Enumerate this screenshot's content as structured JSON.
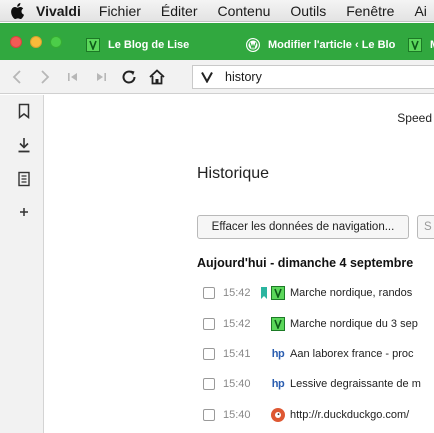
{
  "menubar": {
    "app_name": "Vivaldi",
    "items": [
      "Fichier",
      "Éditer",
      "Contenu",
      "Outils",
      "Fenêtre",
      "Ai"
    ]
  },
  "tabs": [
    {
      "label": "Le Blog de Lise",
      "favicon": "blog-favicon"
    },
    {
      "label": "Modifier l'article ‹ Le Blo",
      "favicon": "wordpress-icon"
    },
    {
      "label": "M",
      "favicon": "blog-favicon"
    }
  ],
  "toolbar": {
    "address_value": "history"
  },
  "content": {
    "speed_dial_label": "Speed",
    "title": "Historique",
    "clear_button": "Effacer les données de navigation...",
    "second_button": "S",
    "day_heading": "Aujourd'hui - dimanche 4 septembre",
    "rows": [
      {
        "time": "15:42",
        "title": "Marche nordique, randos",
        "favicon": "blog-favicon",
        "bookmarked": true
      },
      {
        "time": "15:42",
        "title": "Marche nordique du 3 sep",
        "favicon": "blog-favicon",
        "bookmarked": false
      },
      {
        "time": "15:41",
        "title": "Aan laborex france - proc",
        "favicon": "hp-icon",
        "bookmarked": false
      },
      {
        "time": "15:40",
        "title": "Lessive degraissante de m",
        "favicon": "hp-icon",
        "bookmarked": false
      },
      {
        "time": "15:40",
        "title": "http://r.duckduckgo.com/",
        "favicon": "duckduckgo-icon",
        "bookmarked": false
      }
    ]
  },
  "colors": {
    "tab_bar": "#31a83f",
    "blog_favicon": "#5bd75b",
    "bookmark_marker": "#2bb5a0",
    "hp_icon": "#2a5db0",
    "duckduckgo": "#de5833"
  }
}
